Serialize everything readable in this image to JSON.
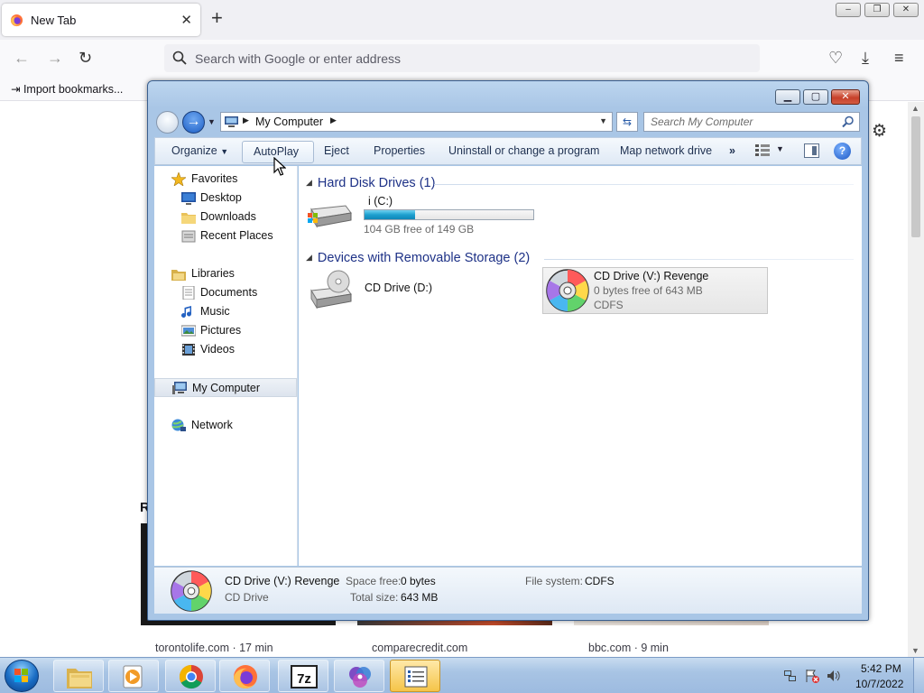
{
  "browser": {
    "tab": {
      "title": "New Tab"
    },
    "window_controls": {
      "minimize": "–",
      "restore": "❐",
      "close": "✕"
    },
    "urlbar": {
      "placeholder": "Search with Google or enter address"
    },
    "bookmarks": {
      "import_label": "Import bookmarks..."
    },
    "recent_heading": "R",
    "cards": [
      {
        "source": "torontolife.com · 17 min"
      },
      {
        "source": "comparecredit.com"
      },
      {
        "source": "bbc.com · 9 min"
      }
    ]
  },
  "explorer": {
    "address": {
      "location": "My Computer"
    },
    "search": {
      "placeholder": "Search My Computer"
    },
    "toolbar": {
      "organize": "Organize",
      "autoplay": "AutoPlay",
      "eject": "Eject",
      "properties": "Properties",
      "uninstall": "Uninstall or change a program",
      "map_drive": "Map network drive",
      "more": "»"
    },
    "nav_pane": {
      "favorites": "Favorites",
      "desktop": "Desktop",
      "downloads": "Downloads",
      "recent_places": "Recent Places",
      "libraries": "Libraries",
      "documents": "Documents",
      "music": "Music",
      "pictures": "Pictures",
      "videos": "Videos",
      "my_computer": "My Computer",
      "network": "Network"
    },
    "groups": {
      "hard_disks": "Hard Disk Drives (1)",
      "removable": "Devices with Removable Storage (2)"
    },
    "drives": {
      "c": {
        "name": "i (C:)",
        "free_text": "104 GB free of 149 GB",
        "used_fraction": 0.3
      },
      "d": {
        "name": "CD Drive (D:)"
      },
      "v": {
        "name": "CD Drive (V:) Revenge",
        "free_text": "0 bytes free of 643 MB",
        "fs": "CDFS"
      }
    },
    "details": {
      "name": "CD Drive (V:) Revenge",
      "type": "CD Drive",
      "space_free_label": "Space free:",
      "space_free_value": "0 bytes",
      "total_size_label": "Total size:",
      "total_size_value": "643 MB",
      "fs_label": "File system:",
      "fs_value": "CDFS"
    }
  },
  "taskbar": {
    "clock_time": "5:42 PM",
    "clock_date": "10/7/2022",
    "apps": [
      "explorer-folders",
      "media-player",
      "chrome",
      "firefox",
      "7zip",
      "cd-burner",
      "notes-app"
    ]
  },
  "colors": {
    "accent_blue": "#1e3287",
    "progress_fill": "#1ea0cf",
    "taskbar": "#a8c4e4"
  }
}
